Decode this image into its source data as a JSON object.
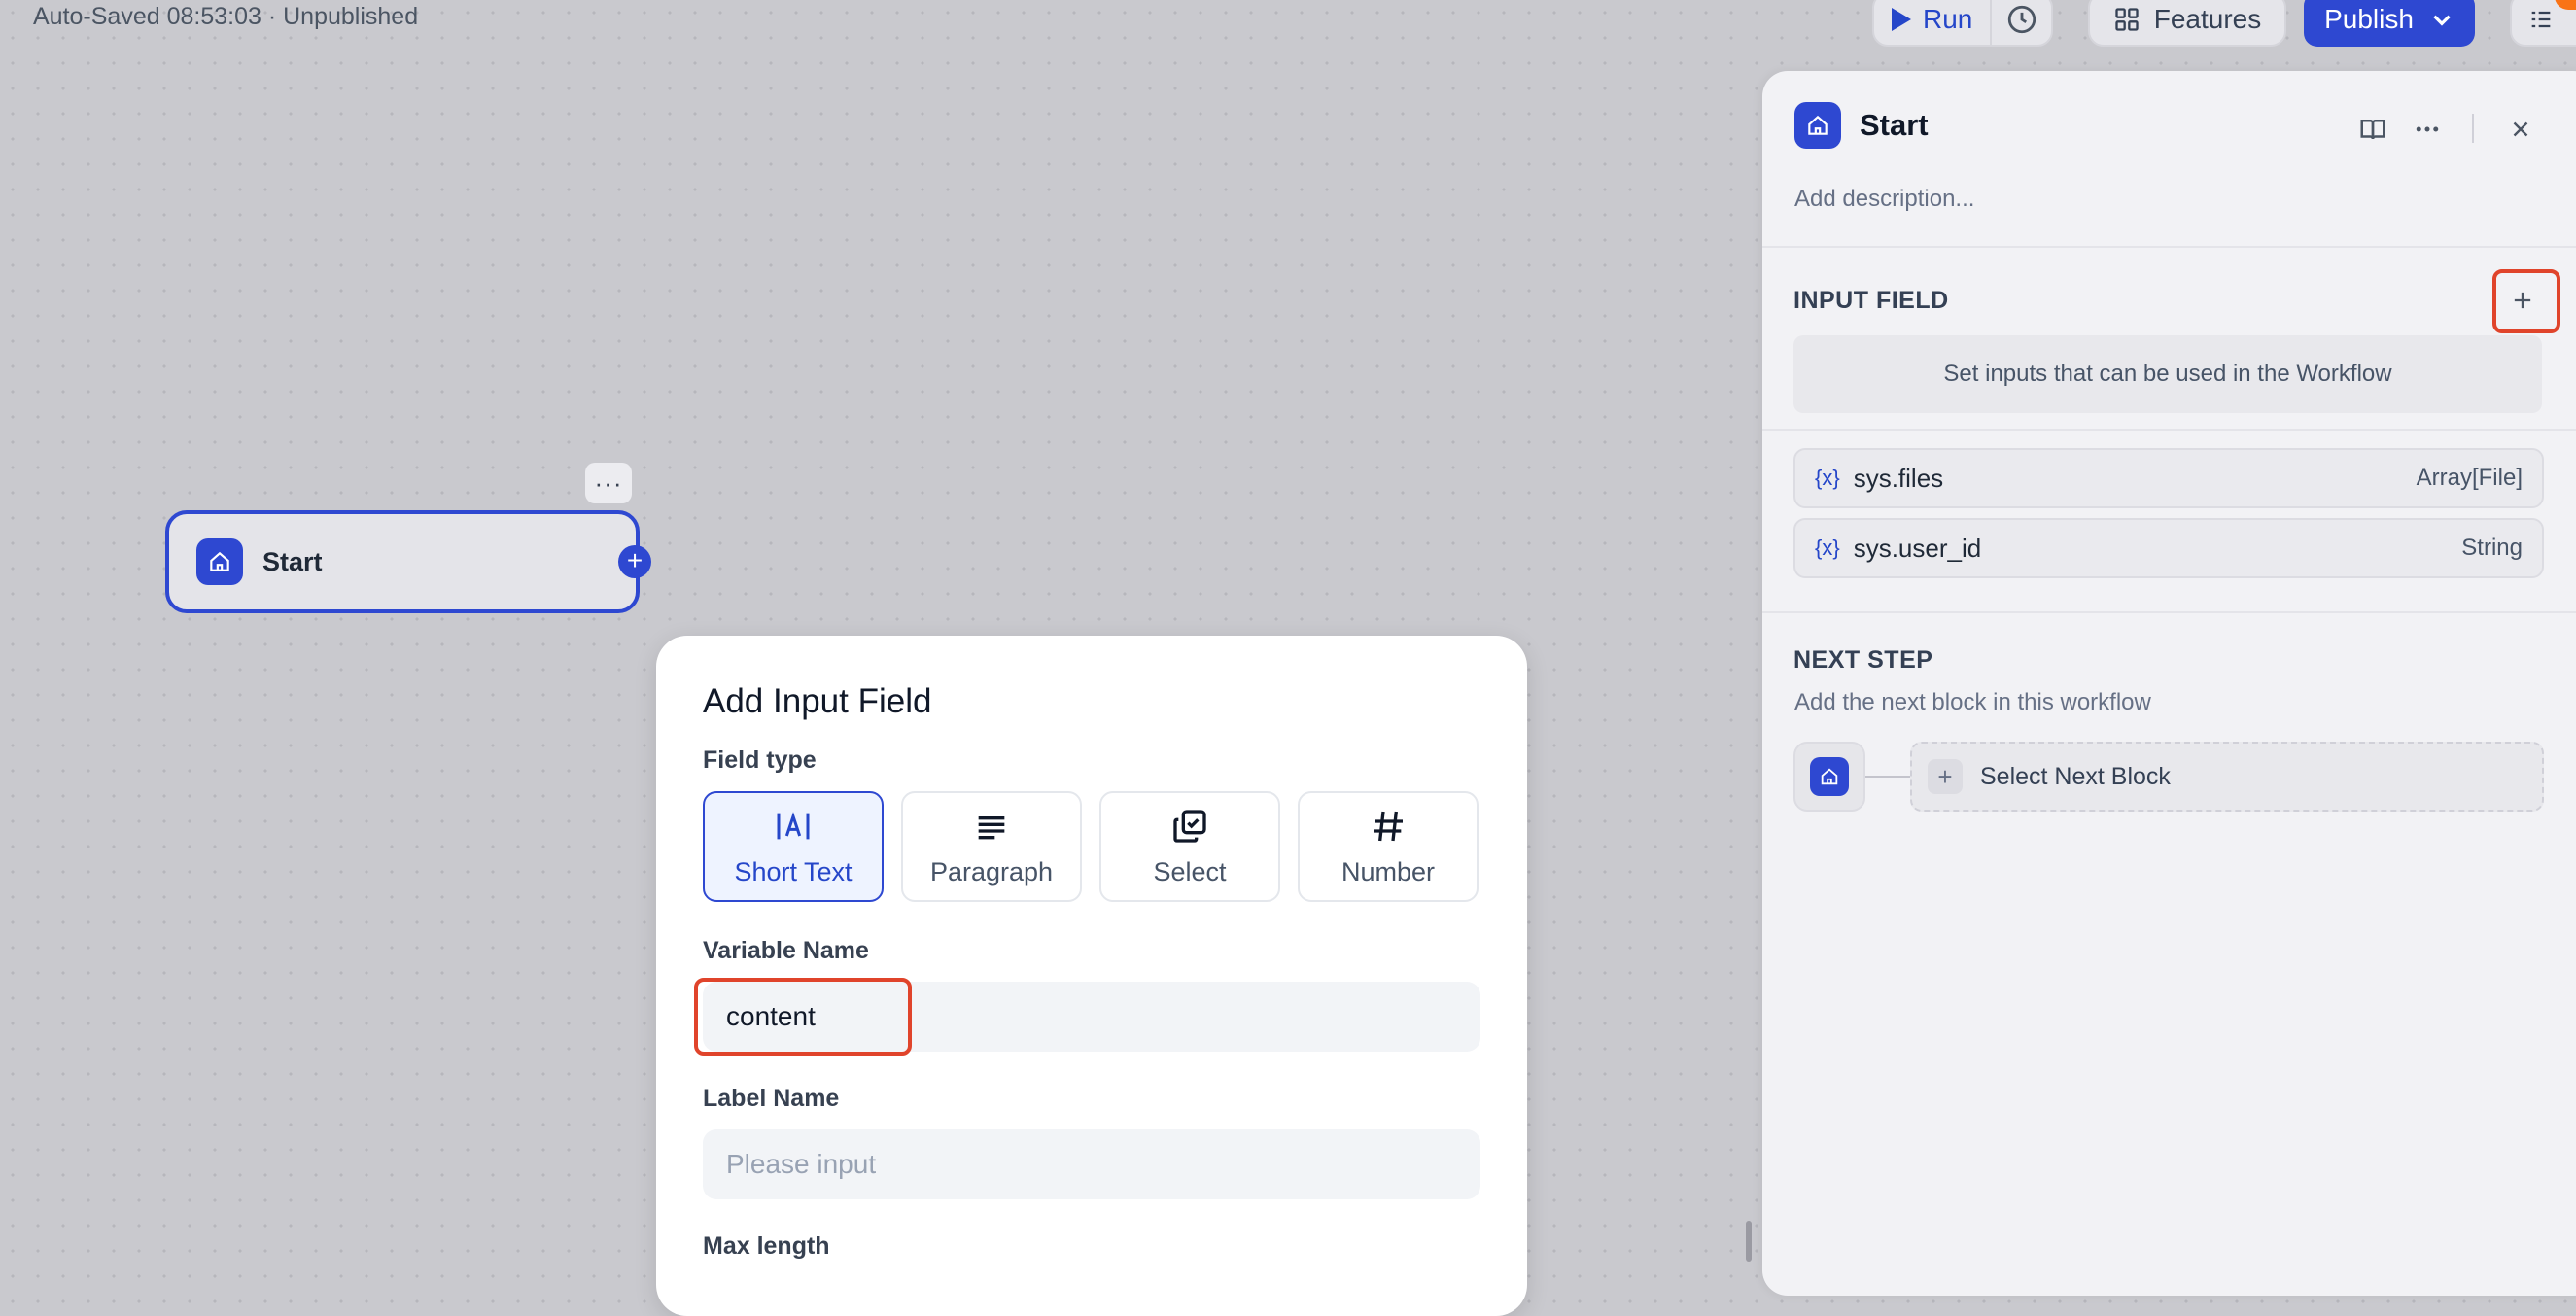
{
  "topbar": {
    "autosave": "Auto-Saved 08:53:03 · Unpublished",
    "run_label": "Run",
    "features_label": "Features",
    "publish_label": "Publish"
  },
  "canvas": {
    "node_title": "Start",
    "node_menu": "···"
  },
  "modal": {
    "title": "Add Input Field",
    "field_type_label": "Field type",
    "field_types": [
      {
        "label": "Short Text",
        "icon": "short-text-icon",
        "selected": true
      },
      {
        "label": "Paragraph",
        "icon": "paragraph-icon",
        "selected": false
      },
      {
        "label": "Select",
        "icon": "select-icon",
        "selected": false
      },
      {
        "label": "Number",
        "icon": "number-icon",
        "selected": false
      }
    ],
    "variable_name_label": "Variable Name",
    "variable_name_value": "content",
    "label_name_label": "Label Name",
    "label_name_placeholder": "Please input",
    "max_length_label": "Max length"
  },
  "panel": {
    "title": "Start",
    "description_placeholder": "Add description...",
    "input_field_title": "INPUT FIELD",
    "input_hint": "Set inputs that can be used in the Workflow",
    "variables": [
      {
        "icon": "{x}",
        "name": "sys.files",
        "type": "Array[File]"
      },
      {
        "icon": "{x}",
        "name": "sys.user_id",
        "type": "String"
      }
    ],
    "next_step_title": "NEXT STEP",
    "next_step_desc": "Add the next block in this workflow",
    "select_next_label": "Select Next Block",
    "plus": "+"
  },
  "colors": {
    "accent": "#2e48d1",
    "highlight": "#e0442b"
  }
}
